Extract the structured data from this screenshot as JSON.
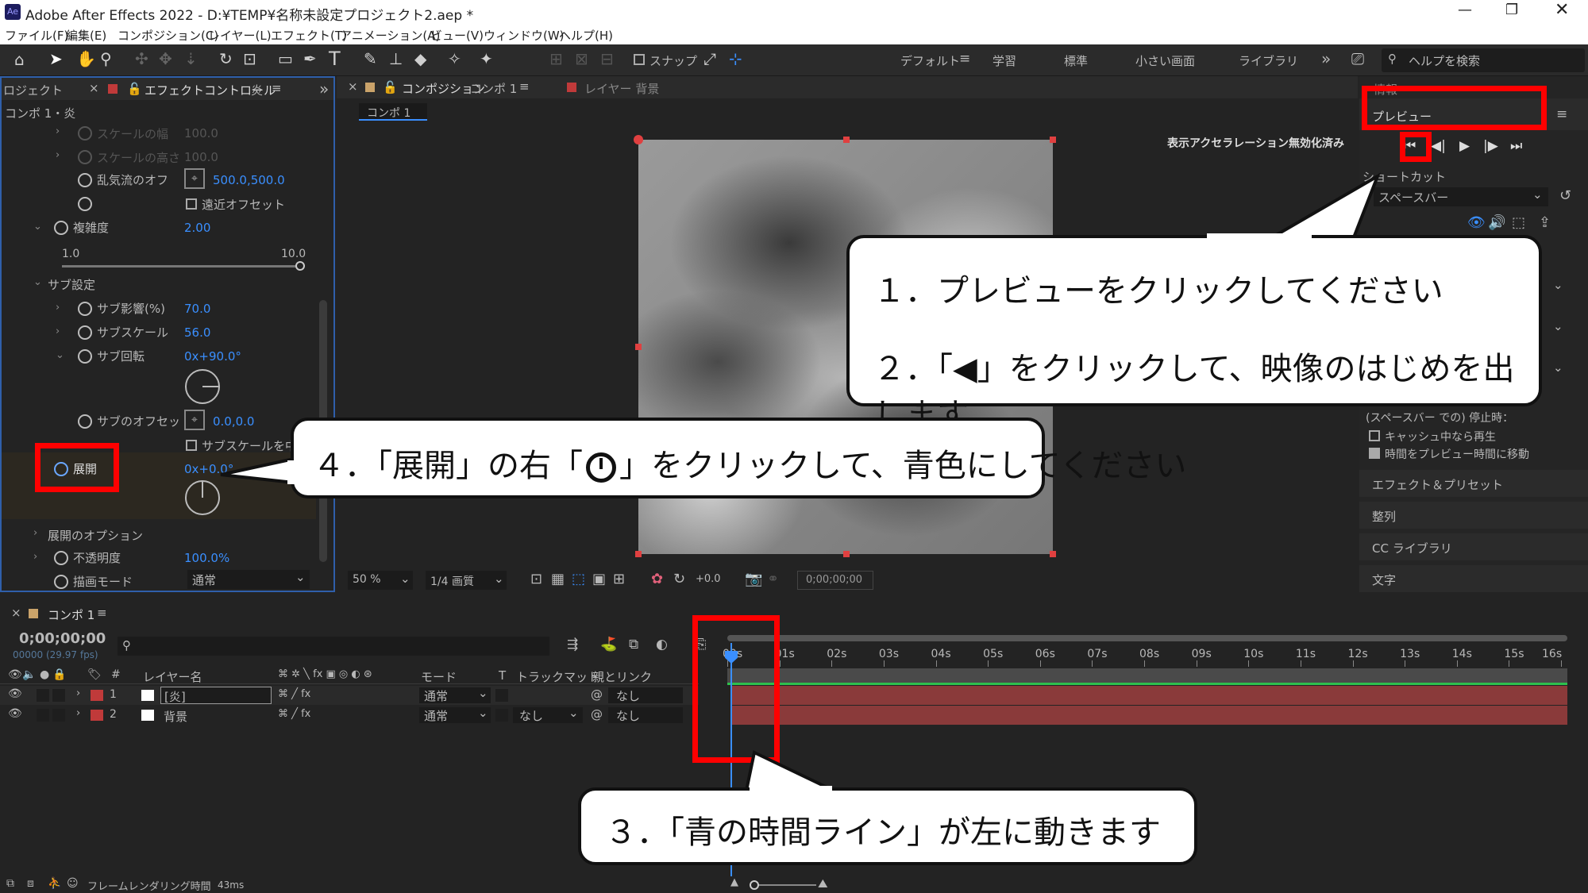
{
  "app": {
    "title": "Adobe After Effects 2022 - D:¥TEMP¥名称未設定プロジェクト2.aep *",
    "logo": "Ae"
  },
  "menu": [
    "ファイル(F)",
    "編集(E)",
    "コンポジション(C)",
    "レイヤー(L)",
    "エフェクト(T)",
    "アニメーション(A)",
    "ビュー(V)",
    "ウィンドウ(W)",
    "ヘルプ(H)"
  ],
  "toolbar": {
    "snap_label": "スナップ",
    "workspaces": [
      "デフォルト",
      "学習",
      "標準",
      "小さい画面",
      "ライブラリ"
    ],
    "search_placeholder": "ヘルプを検索"
  },
  "effects_panel": {
    "project_tab": "ロジェクト",
    "tab_label": "エフェクトコントロール",
    "tab_layer": "炎",
    "subtitle": "コンポ 1・炎",
    "props": {
      "scale_w": "スケールの幅",
      "scale_w_val": "100.0",
      "scale_h": "スケールの高さ",
      "scale_h_val": "100.0",
      "offset": "乱気流のオフ",
      "offset_val": "500.0,500.0",
      "perspective": "遠近オフセット",
      "complexity": "複雑度",
      "complexity_val": "2.00",
      "slider_min": "1.0",
      "slider_max": "10.0",
      "sub_settings": "サブ設定",
      "sub_influence": "サブ影響(%)",
      "sub_influence_val": "70.0",
      "sub_scale": "サブスケール",
      "sub_scale_val": "56.0",
      "sub_rotation": "サブ回転",
      "sub_rotation_val": "0x+90.0°",
      "sub_offset": "サブのオフセッ",
      "sub_offset_val": "0.0,0.0",
      "sub_scale_cb": "サブスケールを中",
      "evolution": "展開",
      "evolution_val": "0x+0.0°",
      "evolution_options": "展開のオプション",
      "opacity": "不透明度",
      "opacity_val": "100.0%",
      "blend_mode": "描画モード",
      "blend_mode_val": "通常"
    }
  },
  "comp_panel": {
    "tab_label": "コンポジション",
    "tab_comp": "コンポ 1",
    "layer_tab": "レイヤー 背景",
    "crumb": "コンポ 1",
    "accel_msg": "表示アクセラレーション無効化済み",
    "zoom": "50 %",
    "quality": "1/4 画質",
    "exposure": "+0.0",
    "timecode": "0;00;00;00"
  },
  "right_panel": {
    "info": "情報",
    "preview": "プレビュー",
    "shortcut": "ショートカット",
    "shortcut_val": "スペースバー",
    "stop_label": "(スペースバー での) 停止時：",
    "cache_cb": "キャッシュ中なら再生",
    "time_cb": "時間をプレビュー時間に移動",
    "sections": [
      "エフェクト＆プリセット",
      "整列",
      "CC ライブラリ",
      "文字"
    ]
  },
  "timeline": {
    "tab": "コンポ 1",
    "timecode": "0;00;00;00",
    "fps": "00000 (29.97 fps)",
    "col_layer": "レイヤー名",
    "col_mode": "モード",
    "col_t": "T",
    "col_track": "トラックマット",
    "col_parent": "親とリンク",
    "layers": [
      {
        "num": "1",
        "name": "[炎]",
        "mode": "通常",
        "track": "",
        "parent": "なし"
      },
      {
        "num": "2",
        "name": "背景",
        "mode": "通常",
        "track": "なし",
        "parent": "なし"
      }
    ],
    "ruler": [
      "00s",
      "01s",
      "02s",
      "03s",
      "04s",
      "05s",
      "06s",
      "07s",
      "08s",
      "09s",
      "10s",
      "11s",
      "12s",
      "13s",
      "14s",
      "15s",
      "16s"
    ],
    "render_label": "フレームレンダリング時間",
    "render_val": "43ms"
  },
  "callouts": {
    "c1": "１．プレビューをクリックしてください",
    "c2": "２．「◀」をクリックして、映像のはじめを出します",
    "c3": "３．「青の時間ライン」が左に動きます",
    "c4a": "４．「展開」の右「",
    "c4b": "」をクリックして、青色にしてください"
  },
  "colors": {
    "accent_blue": "#3a8fff",
    "annotation_red": "#ff0000",
    "layer_red": "#c03a3a",
    "layer_bar": "#8a3a3a"
  }
}
